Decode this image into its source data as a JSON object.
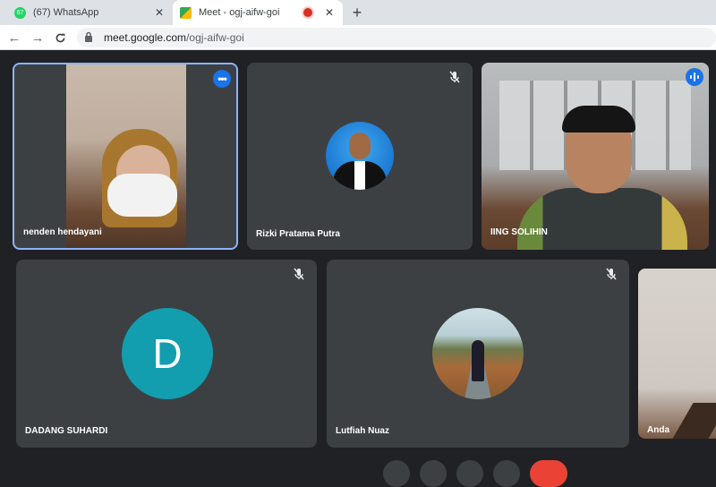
{
  "browser": {
    "tabs": [
      {
        "title": "(67) WhatsApp",
        "badge": "67",
        "active": false
      },
      {
        "title": "Meet - ogj-aifw-goi",
        "active": true
      }
    ],
    "url_host": "meet.google.com",
    "url_path": "/ogj-aifw-goi"
  },
  "meet": {
    "participants": [
      {
        "name": "nenden hendayani",
        "has_video": true
      },
      {
        "name": "Rizki Pratama Putra",
        "muted": true
      },
      {
        "name": "IING SOLIHIN",
        "has_video": true,
        "speaking": true
      },
      {
        "name": "DADANG SUHARDI",
        "muted": true,
        "initial": "D"
      },
      {
        "name": "Lutfiah Nuaz",
        "muted": true
      },
      {
        "name": "Anda",
        "has_video": true
      }
    ],
    "colors": {
      "accent": "#1a73e8",
      "tile": "#3c4043",
      "background": "#202124",
      "letter_avatar": "#129eaf"
    }
  }
}
